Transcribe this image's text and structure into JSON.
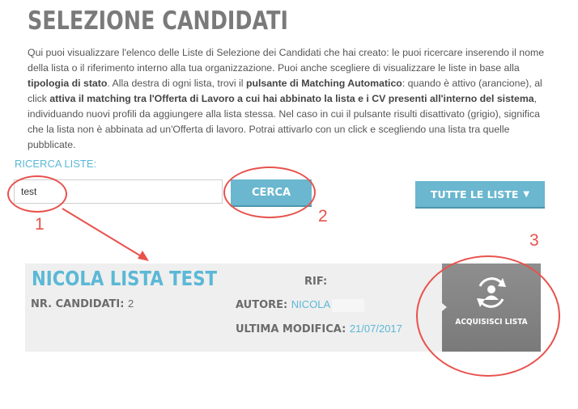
{
  "header": {
    "title": "SELEZIONE CANDIDATI"
  },
  "description": {
    "p1": "Qui puoi visualizzare l'elenco delle Liste di Selezione dei Candidati che hai creato: le puoi ricercare inserendo il nome della lista o il riferimento interno alla tua organizzazione. Puoi anche scegliere di visualizzare le liste in base alla ",
    "b1": "tipologia di stato",
    "p2": ". Alla destra di ogni lista, trovi il ",
    "b2": "pulsante di Matching Automatico",
    "p3": ": quando è attivo (arancione), al click ",
    "b3": "attiva il matching tra l'Offerta di Lavoro a cui hai abbinato la lista e i CV presenti all'interno del sistema",
    "p4": ", individuando nuovi profili da aggiungere alla lista stessa. Nel caso in cui il pulsante risulti disattivato (grigio), significa che la lista non è abbinata ad un'Offerta di lavoro. Potrai attivarlo con un click e scegliendo una lista tra quelle pubblicate."
  },
  "search": {
    "label": "RICERCA LISTE:",
    "value": "test",
    "button_label": "CERCA"
  },
  "filter": {
    "label": "TUTTE LE LISTE",
    "arrow": "▼"
  },
  "list_card": {
    "name": "NICOLA LISTA TEST",
    "candidates_label": "NR. CANDIDATI:",
    "candidates_value": "2",
    "rif_label": "RIF:",
    "rif_value": "",
    "author_label": "AUTORE:",
    "author_value": "NICOLA",
    "modified_label": "ULTIMA MODIFICA:",
    "modified_value": "21/07/2017",
    "acquire_label": "ACQUISISCI LISTA",
    "acquire_icon": "user-sync-icon"
  },
  "annotations": {
    "n1": "1",
    "n2": "2",
    "n3": "3",
    "color": "#e8524d"
  },
  "colors": {
    "accent": "#5bb8d6",
    "button": "#6ab7cf",
    "title": "#7a7a7a",
    "card_bg": "#efefef",
    "acquire_bg": "#858585"
  }
}
